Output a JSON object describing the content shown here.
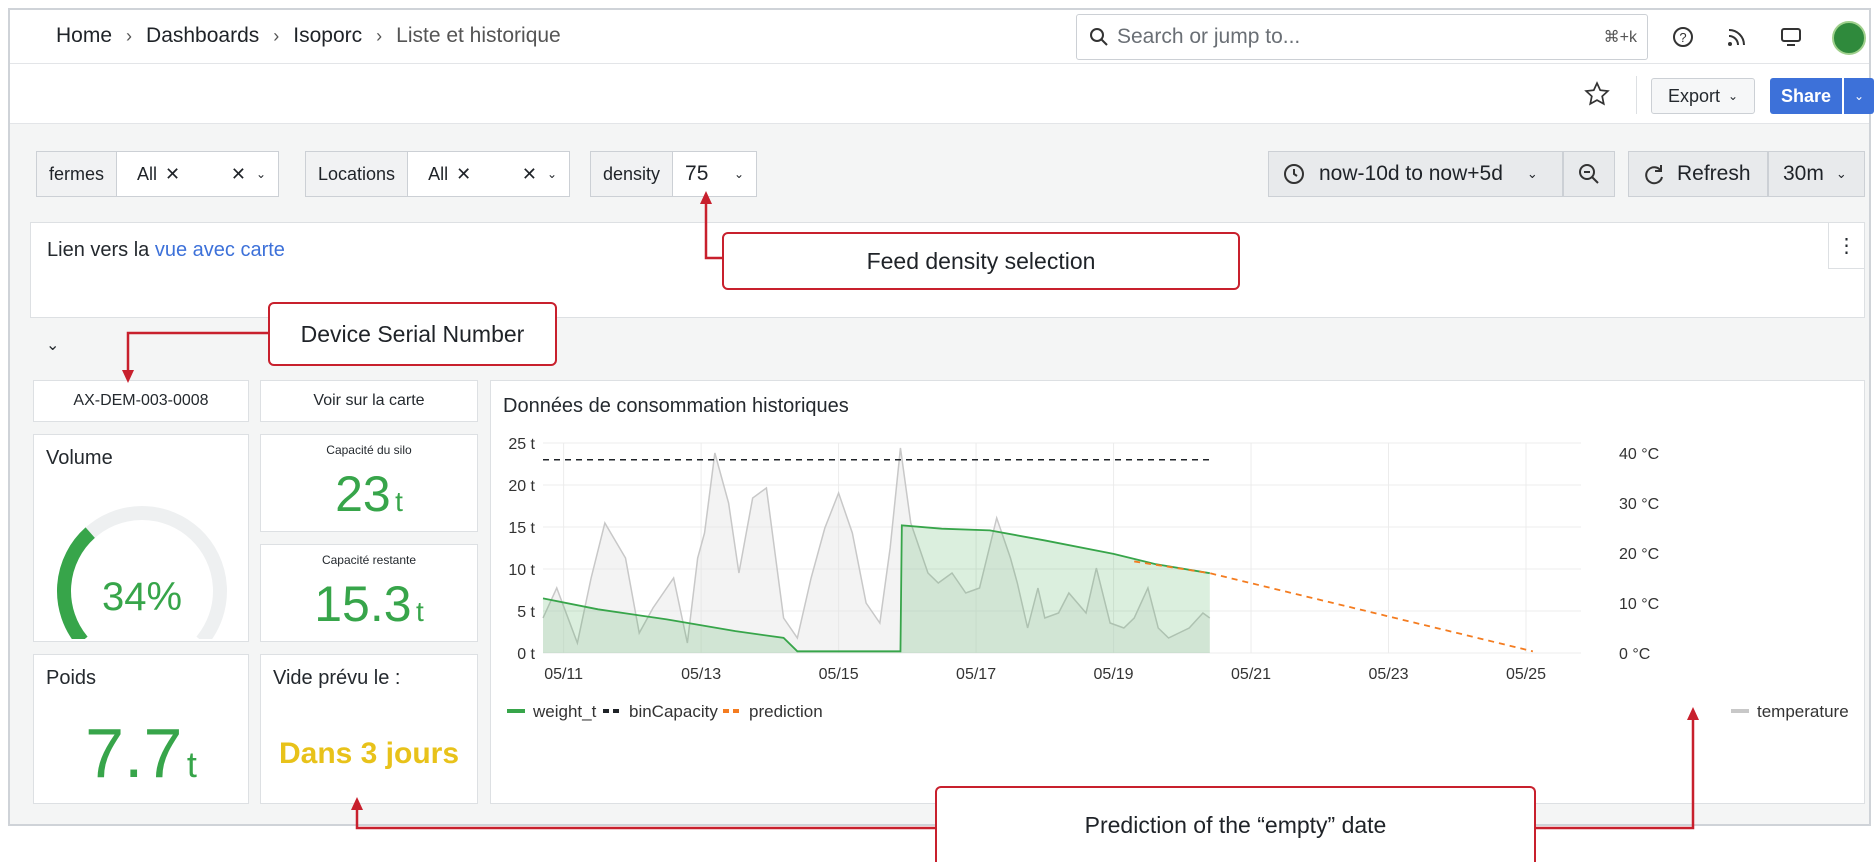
{
  "breadcrumb": [
    "Home",
    "Dashboards",
    "Isoporc",
    "Liste et historique"
  ],
  "search": {
    "placeholder": "Search or jump to...",
    "shortcut": "⌘+k"
  },
  "toolbar": {
    "export_label": "Export",
    "share_label": "Share"
  },
  "variables": [
    {
      "label": "fermes",
      "value": "All"
    },
    {
      "label": "Locations",
      "value": "All"
    },
    {
      "label": "density",
      "value": "75"
    }
  ],
  "time_range": "now-10d to now+5d",
  "refresh": {
    "label": "Refresh",
    "interval": "30m"
  },
  "text_panel": {
    "prefix": "Lien vers la",
    "link": "vue avec carte"
  },
  "device_serial": "AX-DEM-003-0008",
  "map_link": "Voir sur la carte",
  "volume": {
    "title": "Volume",
    "value": "34%",
    "fraction": 0.34
  },
  "silo_capacity": {
    "title": "Capacité du silo",
    "value": "23",
    "unit": "t"
  },
  "remaining_capacity": {
    "title": "Capacité restante",
    "value": "15.3",
    "unit": "t"
  },
  "weight": {
    "title": "Poids",
    "value": "7.7",
    "unit": "t"
  },
  "empty_forecast": {
    "title": "Vide prévu le :",
    "value": "Dans 3 jours"
  },
  "chart_title": "Données de consommation historiques",
  "annotations": {
    "density": "Feed density selection",
    "serial": "Device Serial Number",
    "prediction": "Prediction of the “empty” date"
  },
  "colors": {
    "green": "#37a54a",
    "yellow": "#e8c21a",
    "orange": "#f47c20",
    "blue": "#3d71d9",
    "red": "#c8202d"
  },
  "chart_data": {
    "type": "line",
    "title": "Données de consommation historiques",
    "x_ticks": [
      "05/11",
      "05/13",
      "05/15",
      "05/17",
      "05/19",
      "05/21",
      "05/23",
      "05/25"
    ],
    "y_ticks": [
      "0 t",
      "5 t",
      "10 t",
      "15 t",
      "20 t",
      "25 t"
    ],
    "y2_ticks": [
      "0 °C",
      "10 °C",
      "20 °C",
      "30 °C",
      "40 °C"
    ],
    "ylim": [
      0,
      25
    ],
    "y2lim": [
      0,
      42
    ],
    "xlim": [
      10.7,
      25.8
    ],
    "series": [
      {
        "name": "weight_t",
        "color": "#37a54a",
        "x": [
          10.7,
          11.5,
          12.5,
          13.5,
          14.2,
          14.4,
          15.0,
          15.9,
          15.92,
          16.5,
          17.2,
          18.0,
          19.0,
          19.6,
          20.4
        ],
        "y": [
          6.5,
          5.2,
          4.0,
          2.6,
          1.8,
          0.2,
          0.2,
          0.2,
          15.2,
          14.8,
          14.6,
          13.4,
          11.8,
          10.6,
          9.5
        ]
      },
      {
        "name": "binCapacity",
        "color": "#1f2328",
        "x": [
          10.7,
          20.4
        ],
        "y": [
          23,
          23
        ]
      },
      {
        "name": "prediction",
        "color": "#f47c20",
        "x": [
          19.3,
          20.4,
          25.1
        ],
        "y": [
          10.9,
          9.5,
          0.2
        ]
      },
      {
        "name": "temperature",
        "color": "#c8c8c8",
        "x": [
          10.7,
          10.9,
          11.2,
          11.4,
          11.6,
          11.9,
          12.1,
          12.3,
          12.6,
          12.8,
          12.95,
          13.05,
          13.2,
          13.4,
          13.55,
          13.75,
          13.95,
          14.2,
          14.4,
          14.6,
          14.8,
          15.0,
          15.2,
          15.4,
          15.6,
          15.75,
          15.9,
          16.05,
          16.3,
          16.45,
          16.65,
          16.85,
          17.05,
          17.3,
          17.5,
          17.6,
          17.75,
          17.9,
          18.0,
          18.2,
          18.35,
          18.6,
          18.75,
          18.95,
          19.15,
          19.3,
          19.5,
          19.65,
          19.8,
          19.95,
          20.1,
          20.3,
          20.4
        ],
        "y": [
          7,
          13,
          2,
          15,
          26,
          19,
          4,
          9,
          15,
          2,
          19,
          24,
          40,
          30,
          16,
          31,
          33,
          7,
          3,
          15,
          25,
          32,
          24,
          10,
          6,
          21,
          41,
          26,
          16,
          14,
          16,
          12,
          13,
          27,
          19,
          14,
          5,
          13,
          7,
          8,
          12,
          8,
          17,
          6,
          5,
          7,
          13,
          5,
          3,
          4,
          5,
          8,
          7
        ]
      }
    ],
    "legend": "bottom-left",
    "grid": true
  }
}
